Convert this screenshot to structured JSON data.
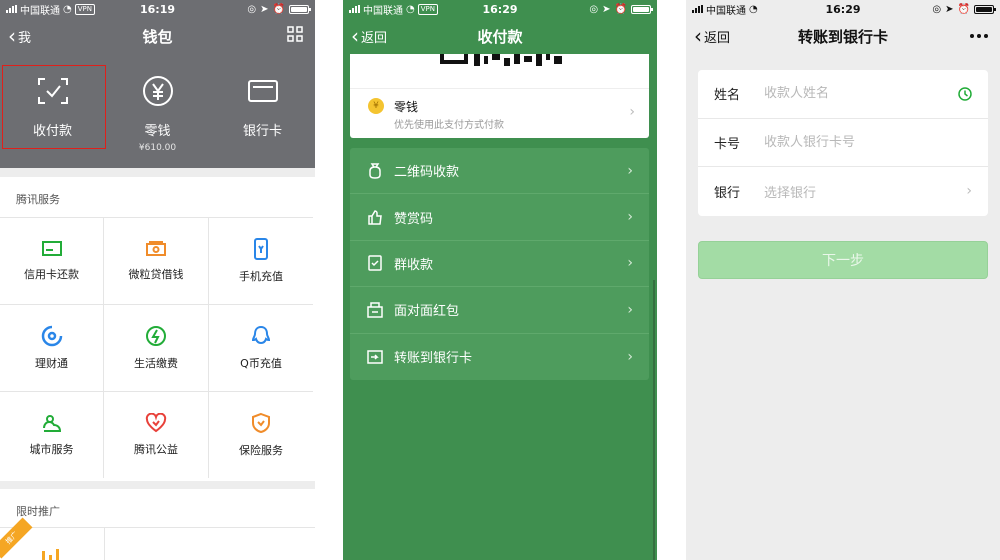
{
  "screen1": {
    "status": {
      "carrier": "中国联通",
      "vpn": "VPN",
      "time": "16:19"
    },
    "nav": {
      "back_label": "我",
      "title": "钱包"
    },
    "top_items": [
      {
        "label": "收付款",
        "icon": "scan-check-icon"
      },
      {
        "label": "零钱",
        "sub": "¥610.00",
        "icon": "yen-circle-icon"
      },
      {
        "label": "银行卡",
        "icon": "card-icon"
      }
    ],
    "services": {
      "title": "腾讯服务",
      "items": [
        {
          "label": "信用卡还款",
          "icon": "credit-card-repay-icon",
          "color": "#22ac38"
        },
        {
          "label": "微粒贷借钱",
          "icon": "loan-icon",
          "color": "#f08c2a"
        },
        {
          "label": "手机充值",
          "icon": "phone-topup-icon",
          "color": "#2a86e8"
        },
        {
          "label": "理财通",
          "icon": "wealth-icon",
          "color": "#2a86e8"
        },
        {
          "label": "生活缴费",
          "icon": "utility-bolt-icon",
          "color": "#22ac38"
        },
        {
          "label": "Q币充值",
          "icon": "qq-icon",
          "color": "#2a86e8"
        },
        {
          "label": "城市服务",
          "icon": "city-service-icon",
          "color": "#22ac38"
        },
        {
          "label": "腾讯公益",
          "icon": "charity-heart-icon",
          "color": "#e8413a"
        },
        {
          "label": "保险服务",
          "icon": "insurance-icon",
          "color": "#f08c2a"
        }
      ]
    },
    "promo": {
      "title": "限时推广",
      "badge": "推广"
    }
  },
  "screen2": {
    "status": {
      "carrier": "中国联通",
      "vpn": "VPN",
      "time": "16:29"
    },
    "nav": {
      "back_label": "返回",
      "title": "收付款"
    },
    "wallet": {
      "title": "零钱",
      "subtitle": "优先使用此支付方式付款",
      "coin": "¥"
    },
    "menu": [
      {
        "label": "二维码收款",
        "icon": "money-bag-icon"
      },
      {
        "label": "赞赏码",
        "icon": "thumb-up-icon"
      },
      {
        "label": "群收款",
        "icon": "group-receipt-icon"
      },
      {
        "label": "面对面红包",
        "icon": "red-packet-icon"
      },
      {
        "label": "转账到银行卡",
        "icon": "bank-transfer-icon"
      }
    ]
  },
  "screen3": {
    "status": {
      "carrier": "中国联通",
      "time": "16:29"
    },
    "nav": {
      "back_label": "返回",
      "title": "转账到银行卡"
    },
    "form": {
      "name_label": "姓名",
      "name_placeholder": "收款人姓名",
      "card_label": "卡号",
      "card_placeholder": "收款人银行卡号",
      "bank_label": "银行",
      "bank_placeholder": "选择银行"
    },
    "next_label": "下一步"
  }
}
